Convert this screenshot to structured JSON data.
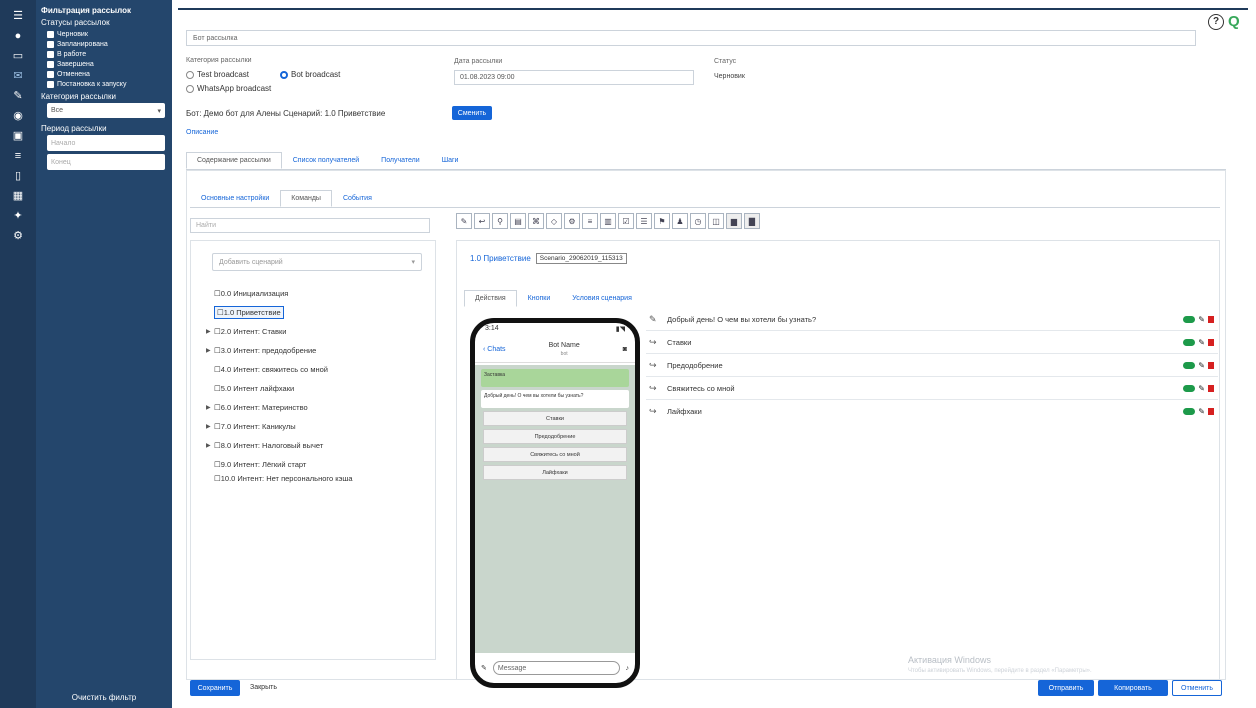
{
  "filter": {
    "title": "Фильтрация рассылок",
    "status_title": "Статусы рассылок",
    "statuses": [
      "Черновик",
      "Запланирована",
      "В работе",
      "Завершена",
      "Отменена",
      "Постановка к запуску"
    ],
    "category_title": "Категория рассылки",
    "category_value": "Все",
    "period_title": "Период рассылки",
    "from_placeholder": "Начало",
    "to_placeholder": "Конец",
    "clear_label": "Очистить фильтр"
  },
  "form": {
    "name_value": "Бот рассылка",
    "category_label": "Категория рассылки",
    "radio_test": "Test broadcast",
    "radio_bot": "Bot broadcast",
    "radio_wa": "WhatsApp broadcast",
    "date_label": "Дата рассылки",
    "date_value": "01.08.2023 09:00",
    "status_label": "Статус",
    "status_value": "Черновик",
    "bot_line": "Бот: Демо бот для Алены Сценарий: 1.0 Приветствие",
    "change_btn": "Сменить",
    "link_label": "Описание"
  },
  "tabs": [
    "Содержание рассылки",
    "Список получателей",
    "Получатели",
    "Шаги"
  ],
  "subtabs": [
    "Основные настройки",
    "Команды",
    "События"
  ],
  "left": {
    "search_placeholder": "Найти",
    "add_scenario_placeholder": "Добавить сценарий",
    "tree": [
      {
        "label": "0.0 Инициализация",
        "arrow": false
      },
      {
        "label": "1.0 Приветствие",
        "arrow": false,
        "selected": true
      },
      {
        "label": "2.0 Интент: Ставки",
        "arrow": true
      },
      {
        "label": "3.0 Интент: предодобрение",
        "arrow": true
      },
      {
        "label": "4.0 Интент: свяжитесь со мной",
        "arrow": false
      },
      {
        "label": "5.0 Интент лайфхаки",
        "arrow": false
      },
      {
        "label": "6.0 Интент: Материнство",
        "arrow": true
      },
      {
        "label": "7.0 Интент: Каникулы",
        "arrow": true
      },
      {
        "label": "8.0 Интент: Налоговый вычет",
        "arrow": true
      },
      {
        "label": "9.0 Интент: Лёгкий старт",
        "arrow": false
      },
      {
        "label": "10.0 Интент: Нет персонального кэша",
        "arrow": false
      }
    ]
  },
  "right": {
    "scenario_title": "1.0 Приветствие",
    "scenario_tag": "Scenario_29062019_115313",
    "inner_tabs": [
      "Действия",
      "Кнопки",
      "Условия сценария"
    ],
    "messages": [
      {
        "icon": "edit",
        "text": "Добрый день! О чем вы хотели бы узнать?"
      },
      {
        "icon": "reply",
        "text": "Ставки"
      },
      {
        "icon": "reply",
        "text": "Предодобрение"
      },
      {
        "icon": "reply",
        "text": "Свяжитесь со мной"
      },
      {
        "icon": "reply",
        "text": "Лайфхаки"
      }
    ]
  },
  "phone": {
    "time": "3:14",
    "back": "‹ Chats",
    "bot_name": "Bot Name",
    "bot_sub": "bot",
    "img_caption": "Заставка",
    "msg_text": "Добрый день! О чем вы хотели бы узнать?",
    "buttons": [
      "Ставки",
      "Предодобрение",
      "Свяжитесь со мной",
      "Лайфхаки"
    ],
    "input_placeholder": "Message"
  },
  "footer": {
    "save": "Сохранить",
    "close": "Закрыть",
    "send": "Отправить",
    "copy": "Копировать",
    "cancel": "Отменить"
  },
  "watermark": {
    "line1": "Активация Windows",
    "line2": "Чтобы активировать Windows, перейдите в раздел «Параметры»."
  },
  "colors": {
    "sidebar": "#1f3a5a",
    "filter": "#24466c",
    "accent": "#1565d8",
    "toggle": "#1d9a4a",
    "danger": "#d62020"
  }
}
